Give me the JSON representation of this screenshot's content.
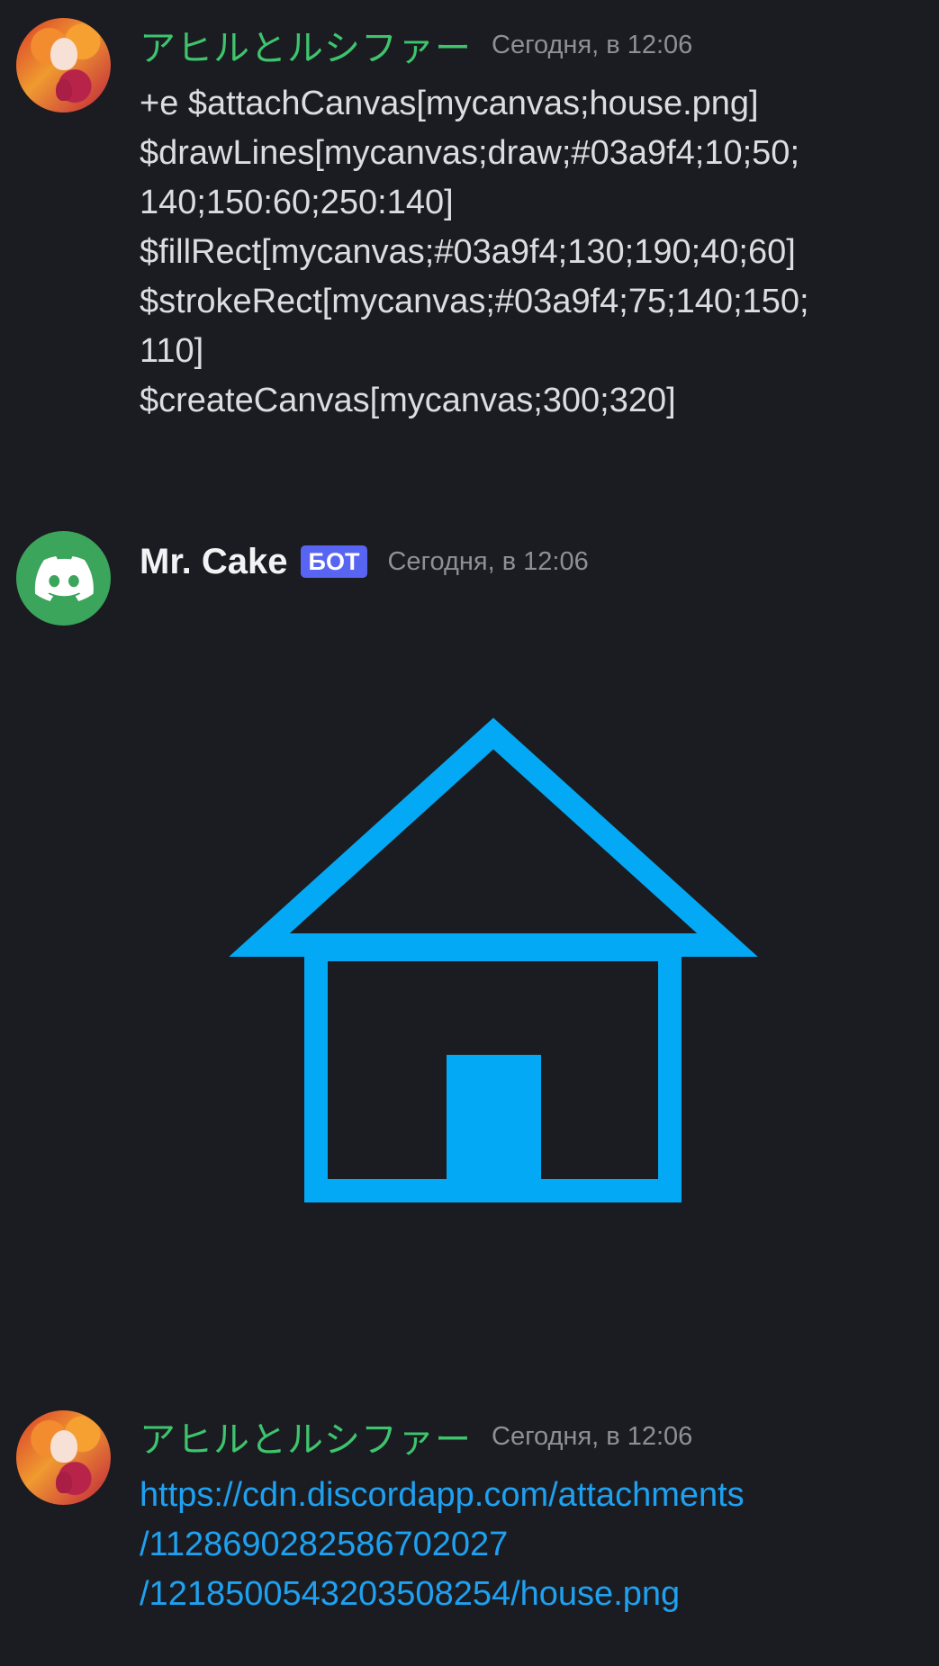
{
  "messages": [
    {
      "author": "アヒルとルシファー",
      "timestamp": "Сегодня, в 12:06",
      "avatar_icon": "anime-character-avatar",
      "lines": [
        "+e $attachCanvas[mycanvas;house.png]",
        "$drawLines[mycanvas;draw;#03a9f4;10;50;",
        "140;150:60;250:140]",
        "$fillRect[mycanvas;#03a9f4;130;190;40;60]",
        "$strokeRect[mycanvas;#03a9f4;75;140;150;",
        "110]",
        "$createCanvas[mycanvas;300;320]"
      ]
    },
    {
      "author": "Mr. Cake",
      "badge": "БОТ",
      "timestamp": "Сегодня, в 12:06",
      "avatar_icon": "discord-logo-icon",
      "attachment": {
        "icon": "house-drawing",
        "color": "#03a9f4"
      }
    },
    {
      "author": "アヒルとルシファー",
      "timestamp": "Сегодня, в 12:06",
      "avatar_icon": "anime-character-avatar",
      "link_lines": [
        "https://cdn.discordapp.com/attachments",
        "/1128690282586702027",
        "/1218500543203508254/house.png"
      ]
    }
  ],
  "colors": {
    "background": "#1b1c21",
    "username_green": "#3ec46d",
    "bot_badge": "#5865f2",
    "link": "#1ea1f1",
    "canvas_blue": "#03a9f4",
    "discord_avatar": "#3ba55c"
  }
}
